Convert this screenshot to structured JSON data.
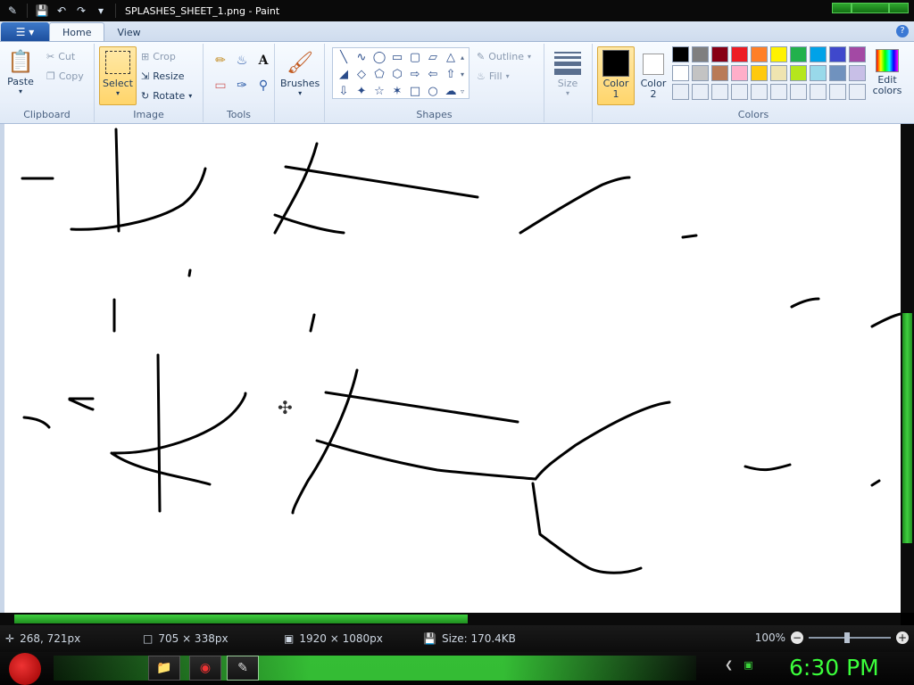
{
  "window": {
    "title": "SPLASHES_SHEET_1.png - Paint"
  },
  "tabs": [
    {
      "label": "Home"
    },
    {
      "label": "View"
    }
  ],
  "ribbon": {
    "clipboard": {
      "paste": "Paste",
      "cut": "Cut",
      "copy": "Copy",
      "group": "Clipboard"
    },
    "image": {
      "select": "Select",
      "crop": "Crop",
      "resize": "Resize",
      "rotate": "Rotate",
      "group": "Image"
    },
    "tools": {
      "group": "Tools"
    },
    "brushes": {
      "label": "Brushes"
    },
    "shapes": {
      "outline": "Outline",
      "fill": "Fill",
      "group": "Shapes"
    },
    "size": {
      "label": "Size"
    },
    "colors": {
      "color1": "Color 1",
      "color2": "Color 2",
      "edit": "Edit colors",
      "group": "Colors",
      "color1_value": "#000000",
      "color2_value": "#ffffff",
      "palette": [
        "#000000",
        "#7f7f7f",
        "#880015",
        "#ed1c24",
        "#ff7f27",
        "#fff200",
        "#22b14c",
        "#00a2e8",
        "#3f48cc",
        "#a349a4",
        "#ffffff",
        "#c3c3c3",
        "#b97a57",
        "#ffaec9",
        "#ffc90e",
        "#efe4b0",
        "#b5e61d",
        "#99d9ea",
        "#7092be",
        "#c8bfe7",
        "#e8eef7",
        "#e8eef7",
        "#e8eef7",
        "#e8eef7",
        "#e8eef7",
        "#e8eef7",
        "#e8eef7",
        "#e8eef7",
        "#e8eef7",
        "#e8eef7"
      ]
    }
  },
  "status": {
    "cursor_pos": "268, 721px",
    "selection_size": "705 × 338px",
    "image_size": "1920 × 1080px",
    "file_size": "Size: 170.4KB",
    "zoom": "100%"
  },
  "taskbar": {
    "clock": "6:30 PM"
  }
}
